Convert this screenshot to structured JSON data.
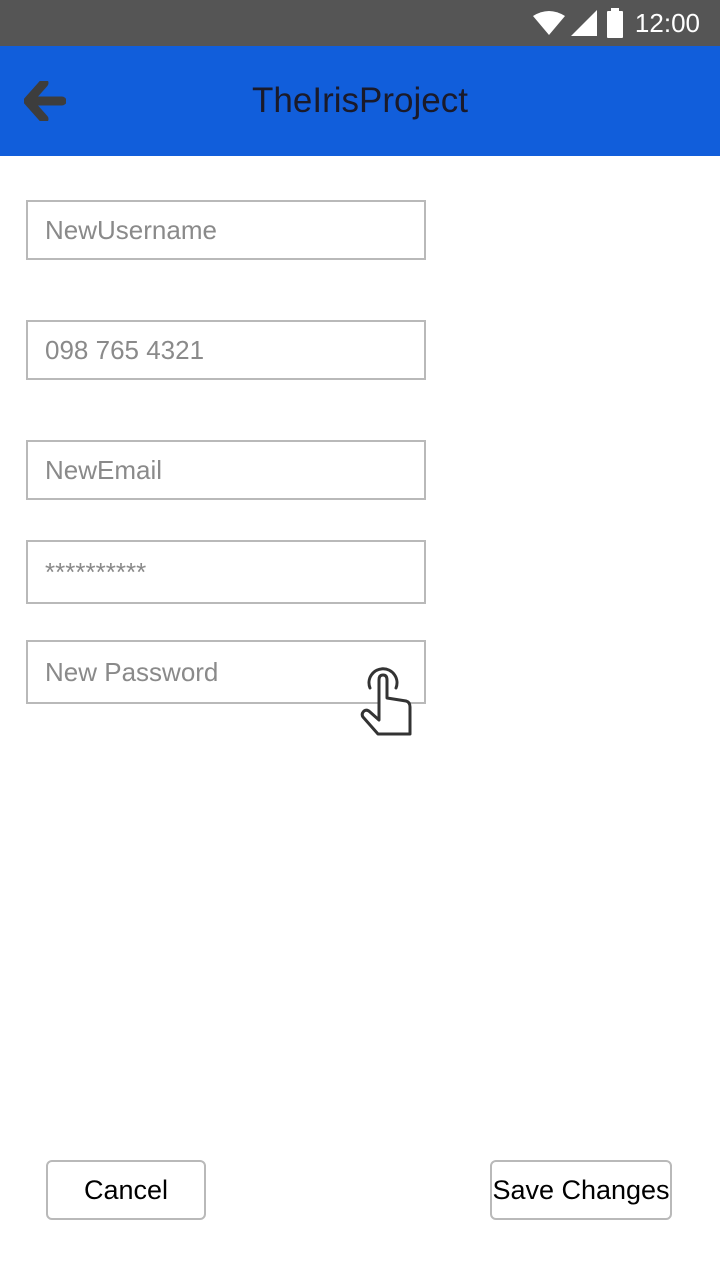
{
  "status_bar": {
    "time": "12:00",
    "icons": [
      "wifi-icon",
      "cell-signal-icon",
      "battery-icon"
    ],
    "background": "#555555"
  },
  "app_bar": {
    "title": "TheIrisProject",
    "back_icon": "arrow-left-icon",
    "background": "#115edb"
  },
  "form": {
    "username_placeholder": "NewUsername",
    "phone_placeholder": "098 765 4321",
    "email_placeholder": "NewEmail",
    "current_password_masked": "**********",
    "new_password_placeholder": "New Password"
  },
  "touch_indicator_icon": "tap-hand-icon",
  "actions": {
    "cancel_label": "Cancel",
    "save_label": "Save Changes"
  }
}
